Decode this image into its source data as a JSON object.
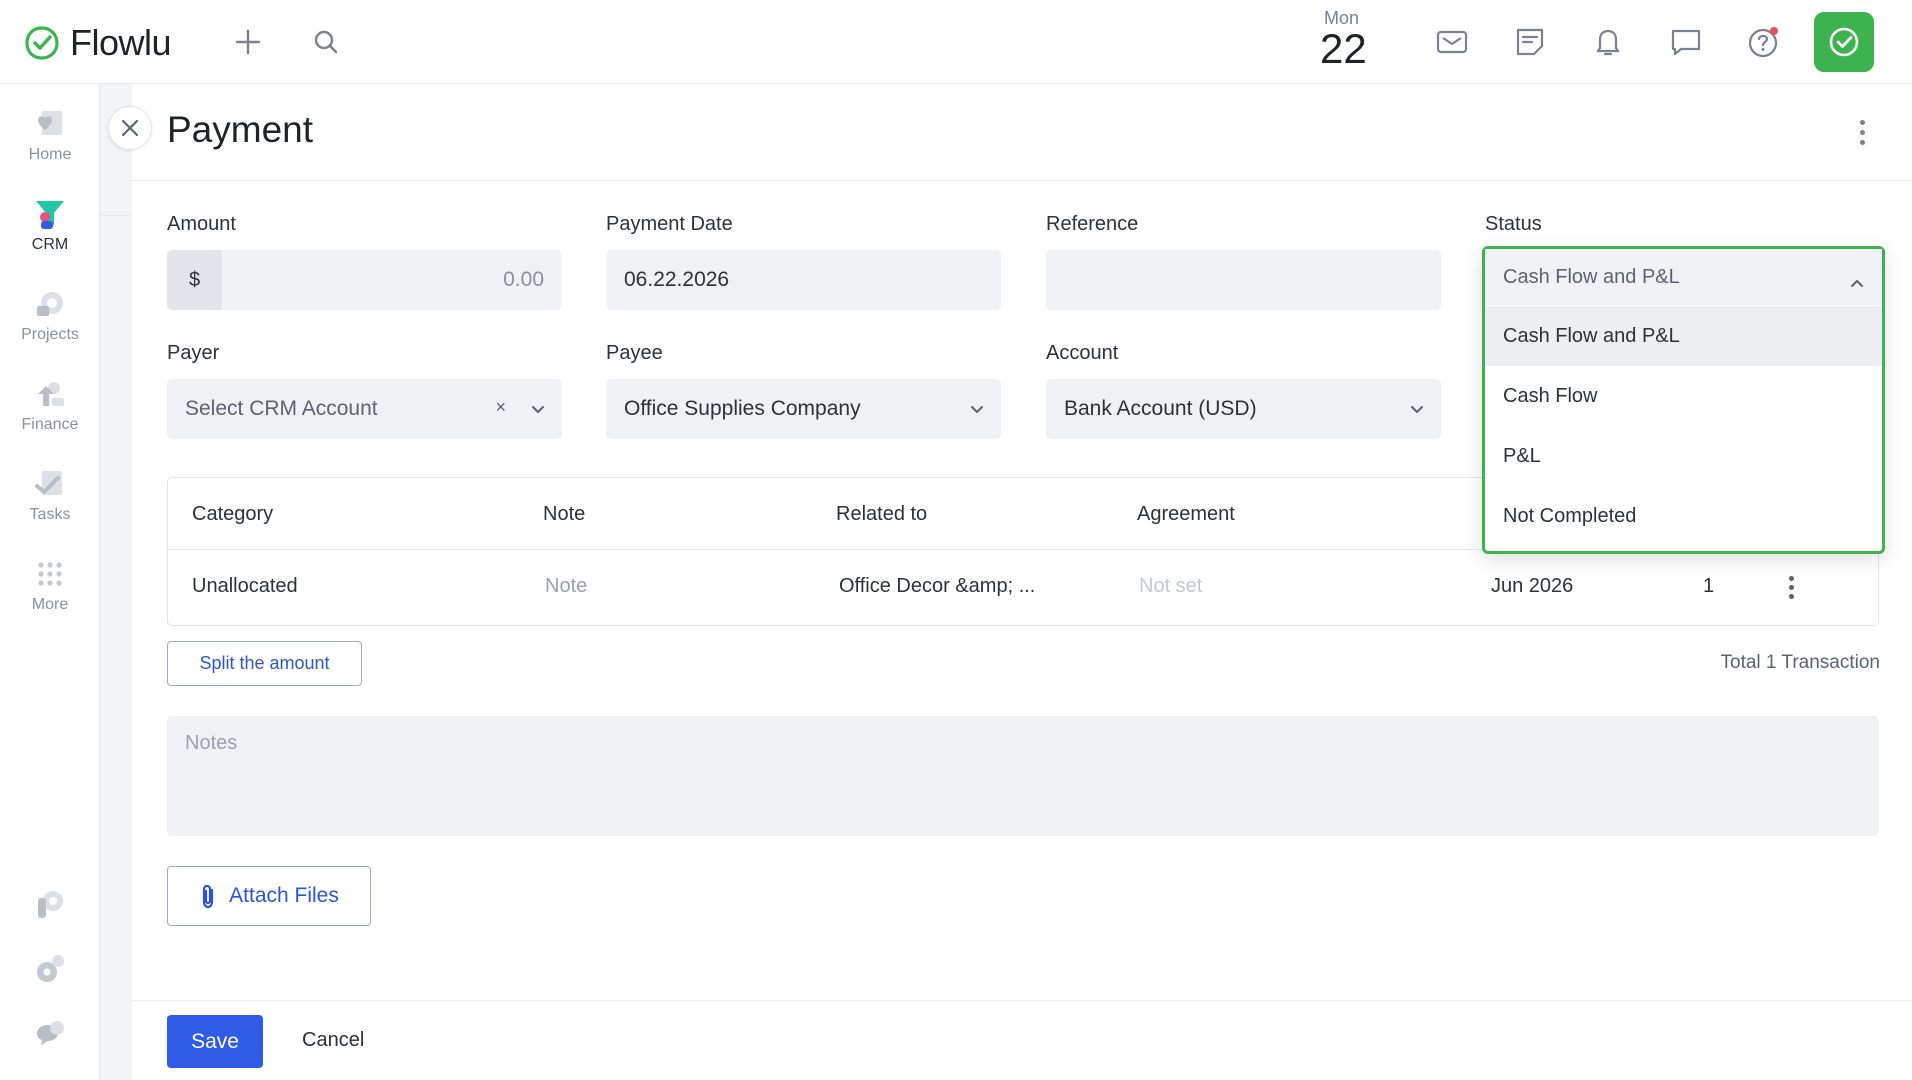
{
  "app": {
    "name": "Flowlu"
  },
  "header": {
    "date_day": "Mon",
    "date_num": "22"
  },
  "sidebar": {
    "items": [
      {
        "label": "Home"
      },
      {
        "label": "CRM"
      },
      {
        "label": "Projects"
      },
      {
        "label": "Finance"
      },
      {
        "label": "Tasks"
      },
      {
        "label": "More"
      }
    ]
  },
  "page": {
    "title": "Payment"
  },
  "form": {
    "amount": {
      "label": "Amount",
      "currency": "$",
      "value": "0.00"
    },
    "payment_date": {
      "label": "Payment Date",
      "value": "06.22.2026"
    },
    "reference": {
      "label": "Reference",
      "value": ""
    },
    "status": {
      "label": "Status",
      "value": "Cash Flow and P&L",
      "options": [
        "Cash Flow and P&L",
        "Cash Flow",
        "P&L",
        "Not Completed"
      ]
    },
    "payer": {
      "label": "Payer",
      "value": "Select CRM Account"
    },
    "payee": {
      "label": "Payee",
      "value": "Office Supplies Company"
    },
    "account": {
      "label": "Account",
      "value": "Bank Account (USD)"
    }
  },
  "table": {
    "headers": [
      "Category",
      "Note",
      "Related to",
      "Agreement"
    ],
    "rows": [
      {
        "category": "Unallocated",
        "note": "Note",
        "related_to": "Office Decor &amp; ...",
        "agreement": "Not set",
        "period": "Jun 2026",
        "qty": "1"
      }
    ]
  },
  "split_label": "Split the amount",
  "total_label": "Total 1 Transaction",
  "notes_placeholder": "Notes",
  "attach_label": "Attach Files",
  "footer": {
    "save": "Save",
    "cancel": "Cancel"
  },
  "colors": {
    "accent": "#3cb34f",
    "primary": "#2f5be6"
  }
}
